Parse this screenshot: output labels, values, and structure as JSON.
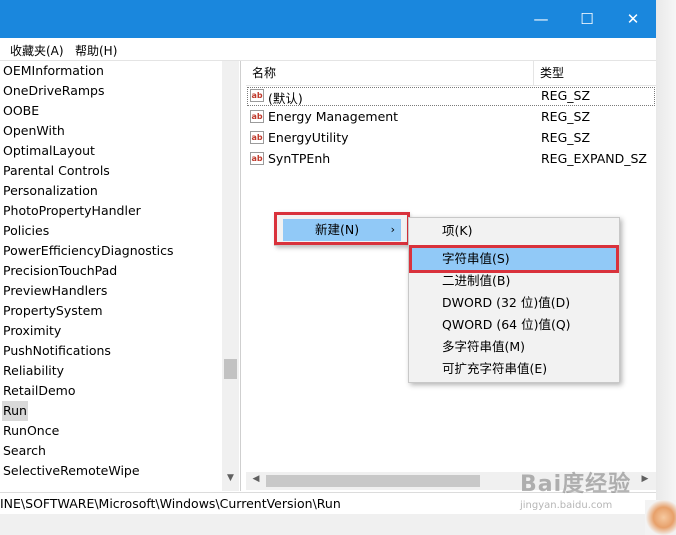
{
  "window": {
    "controls": {
      "minimize": "—",
      "maximize": "☐",
      "close": "✕"
    }
  },
  "menubar": {
    "favorites": "收藏夹(A)",
    "help": "帮助(H)"
  },
  "tree": {
    "items": [
      "OEMInformation",
      "OneDriveRamps",
      "OOBE",
      "OpenWith",
      "OptimalLayout",
      "Parental Controls",
      "Personalization",
      "PhotoPropertyHandler",
      "Policies",
      "PowerEfficiencyDiagnostics",
      "PrecisionTouchPad",
      "PreviewHandlers",
      "PropertySystem",
      "Proximity",
      "PushNotifications",
      "Reliability",
      "RetailDemo",
      "Run",
      "RunOnce",
      "Search",
      "SelectiveRemoteWipe"
    ],
    "selected": "Run",
    "scroll_down_arrow": "▼"
  },
  "list": {
    "columns": {
      "name": "名称",
      "type": "类型"
    },
    "rows": [
      {
        "icon": "ab",
        "name": "(默认)",
        "type": "REG_SZ"
      },
      {
        "icon": "ab",
        "name": "Energy Management",
        "type": "REG_SZ"
      },
      {
        "icon": "ab",
        "name": "EnergyUtility",
        "type": "REG_SZ"
      },
      {
        "icon": "ab",
        "name": "SynTPEnh",
        "type": "REG_EXPAND_SZ"
      }
    ],
    "hscroll_left": "◀",
    "hscroll_right": "▶"
  },
  "status": {
    "path": "INE\\SOFTWARE\\Microsoft\\Windows\\CurrentVersion\\Run"
  },
  "context_menu": {
    "new_label": "新建(N)",
    "arrow": "›"
  },
  "submenu": {
    "items": [
      "项(K)",
      "字符串值(S)",
      "二进制值(B)",
      "DWORD (32 位)值(D)",
      "QWORD (64 位)值(Q)",
      "多字符串值(M)",
      "可扩充字符串值(E)"
    ],
    "hovered": "字符串值(S)"
  },
  "watermark": {
    "logo": "Bai度经验",
    "url": "jingyan.baidu.com"
  },
  "colors": {
    "titlebar": "#1a87dd",
    "menu_highlight": "#91c9f7",
    "annotation_red": "#d9323c"
  }
}
